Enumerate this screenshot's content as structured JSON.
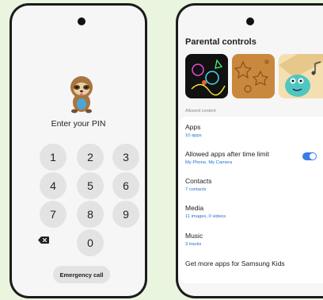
{
  "pin_screen": {
    "title": "Enter your PIN",
    "keys": [
      "1",
      "2",
      "3",
      "4",
      "5",
      "6",
      "7",
      "8",
      "9",
      "0"
    ],
    "backspace_icon": "backspace-icon",
    "emergency_label": "Emergency call"
  },
  "parental": {
    "title": "Parental controls",
    "section_label": "Allowed content",
    "items": [
      {
        "title": "Apps",
        "subtitle": "10 apps"
      },
      {
        "title": "Allowed apps after time limit",
        "subtitle": "My Phone, My Camera"
      },
      {
        "title": "Contacts",
        "subtitle": "7 contacts"
      },
      {
        "title": "Media",
        "subtitle": "11 images, 0 videos"
      },
      {
        "title": "Music",
        "subtitle": "3 tracks"
      },
      {
        "title": "Get more apps for Samsung Kids"
      }
    ],
    "time_limit_toggle_on": true
  },
  "colors": {
    "background": "#eaf5df",
    "accent": "#1e6fd0",
    "toggle": "#3a7ee4",
    "key": "#e3e3e3"
  }
}
